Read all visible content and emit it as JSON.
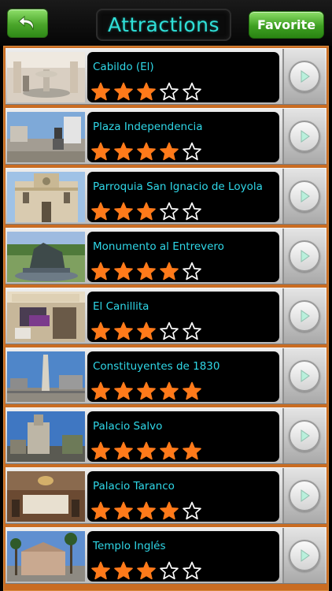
{
  "header": {
    "title": "Attractions",
    "favorite_label": "Favorite"
  },
  "icons": {
    "back": "back-arrow-icon",
    "go": "chevron-right-icon",
    "star_filled": "star-filled-icon",
    "star_empty": "star-outline-icon"
  },
  "colors": {
    "accent_cyan": "#2fd8e8",
    "star_orange": "#ff7a1a",
    "button_green": "#3e9f22",
    "list_frame": "#c96c22"
  },
  "attractions": [
    {
      "name": "Cabildo (El)",
      "rating": 3,
      "max_rating": 5,
      "photo": "courtyard-fountain"
    },
    {
      "name": "Plaza Independencia",
      "rating": 4,
      "max_rating": 5,
      "photo": "plaza-statue"
    },
    {
      "name": "Parroquia San Ignacio de Loyola",
      "rating": 3,
      "max_rating": 5,
      "photo": "church-facade"
    },
    {
      "name": "Monumento al Entrevero",
      "rating": 4,
      "max_rating": 5,
      "photo": "bronze-monument"
    },
    {
      "name": "El Canillita",
      "rating": 3,
      "max_rating": 5,
      "photo": "cafe-storefront"
    },
    {
      "name": "Constituyentes de 1830",
      "rating": 5,
      "max_rating": 5,
      "photo": "obelisk"
    },
    {
      "name": "Palacio Salvo",
      "rating": 5,
      "max_rating": 5,
      "photo": "tower-building"
    },
    {
      "name": "Palacio Taranco",
      "rating": 4,
      "max_rating": 5,
      "photo": "palace-interior"
    },
    {
      "name": "Templo Inglés",
      "rating": 3,
      "max_rating": 5,
      "photo": "temple-palms"
    }
  ]
}
